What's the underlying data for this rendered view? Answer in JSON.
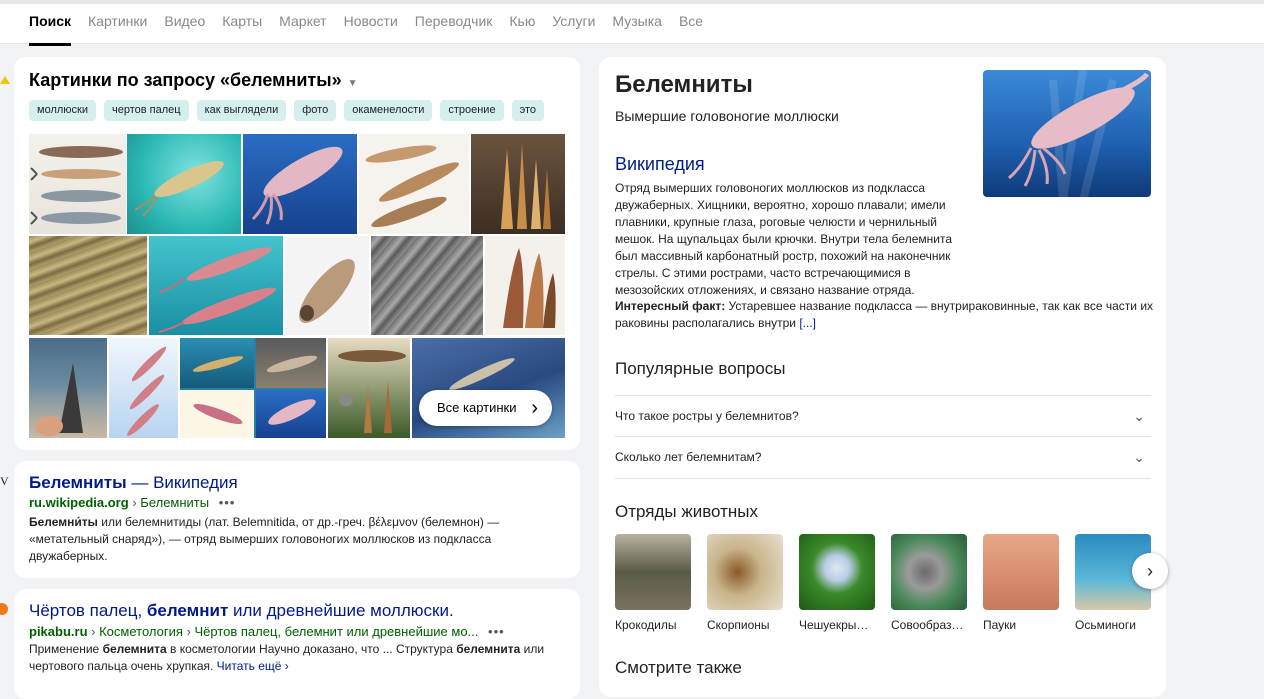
{
  "nav": {
    "tabs": [
      "Поиск",
      "Картинки",
      "Видео",
      "Карты",
      "Маркет",
      "Новости",
      "Переводчик",
      "Кью",
      "Услуги",
      "Музыка",
      "Все"
    ]
  },
  "images_block": {
    "title": "Картинки по запросу «белемниты»",
    "chips": [
      "моллюски",
      "чертов палец",
      "как выглядели",
      "фото",
      "окаменелости",
      "строение",
      "это"
    ],
    "all_button": "Все картинки"
  },
  "results": [
    {
      "title_bold": "Белемниты",
      "title_rest": " — Википедия",
      "domain": "ru.wikipedia.org",
      "path": "Белемниты",
      "snippet_bold": "Белемни́ты",
      "snippet": " или белемнитиды (лат. Belemnitida, от др.-греч. βέλεμνον (белемнон) — «метательный снаряд»), — отряд вымерших головоногих моллюсков из подкласса двужаберных."
    },
    {
      "title_a": "Чёртов палец, ",
      "title_bold": "белемнит",
      "title_b": " или древнейшие моллюски.",
      "domain": "pikabu.ru",
      "path1": "Косметология",
      "path2": "Чёртов палец, белемнит или древнейшие мо...",
      "snippet_a": "Применение ",
      "snippet_bold1": "белемнита",
      "snippet_b": " в косметологии Научно доказано, что ... Структура ",
      "snippet_bold2": "белемнита",
      "snippet_c": " или чертового пальца очень хрупкая.",
      "read_more": "Читать ещё"
    }
  ],
  "panel": {
    "title": "Белемниты",
    "subtitle": "Вымершие головоногие моллюски",
    "wiki_label": "Википедия",
    "wiki_text": "Отряд вымерших головоногих моллюсков из подкласса двужаберных. Хищники, вероятно, хорошо плавали; имели плавники, крупные глаза, роговые челюсти и чернильный мешок. На щупальцах были крючки. Внутри тела белемнита был массивный карбонатный ростр, похожий на наконечник стрелы. С этими рострами, часто встречающимися в мезозойских отложениях, и связано название отряда.",
    "fact_label": "Интересный факт:",
    "fact_text": " Устаревшее название подкласса — внутрираковинные, так как все части их раковины располагались внутри",
    "fact_more": "[...]",
    "popular_title": "Популярные вопросы",
    "questions": [
      "Что такое ростры у белемнитов?",
      "Сколько лет белемнитам?"
    ],
    "orders_title": "Отряды животных",
    "orders": [
      "Крокодилы",
      "Скорпионы",
      "Чешуекры…",
      "Совообраз…",
      "Пауки",
      "Осьминоги"
    ],
    "see_also": "Смотрите также"
  },
  "colors": {
    "link": "#001a8c",
    "url_green": "#006000",
    "chip_bg": "#d5efef"
  }
}
